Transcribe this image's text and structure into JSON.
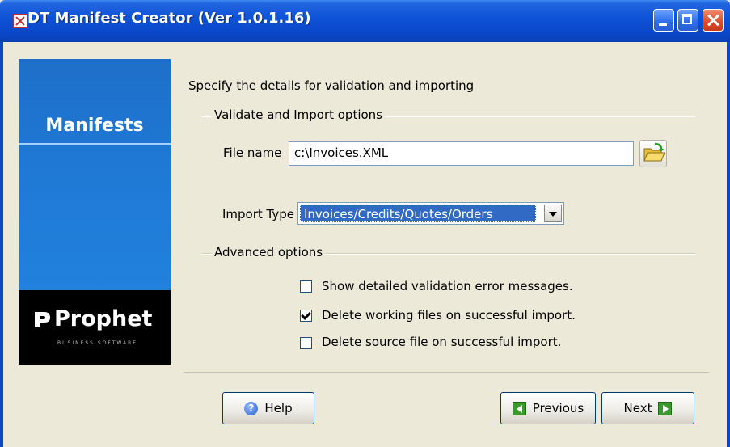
{
  "window": {
    "title": "DT Manifest Creator (Ver 1.0.1.16)"
  },
  "sidebar": {
    "title": "Manifests",
    "logo_text": "Prophet",
    "logo_subtitle": "BUSINESS SOFTWARE"
  },
  "main": {
    "intro": "Specify the details for validation and importing",
    "validate_group": {
      "label": "Validate and Import options",
      "file_name_label": "File name",
      "file_name_value": "c:\\Invoices.XML",
      "import_type_label": "Import Type",
      "import_type_value": "Invoices/Credits/Quotes/Orders"
    },
    "advanced_group": {
      "label": "Advanced options",
      "options": [
        {
          "label": "Show detailed validation error messages.",
          "checked": false
        },
        {
          "label": "Delete working files on successful import.",
          "checked": true
        },
        {
          "label": "Delete source file on successful import.",
          "checked": false
        }
      ]
    }
  },
  "footer": {
    "help_label": "Help",
    "previous_label": "Previous",
    "next_label": "Next"
  },
  "colors": {
    "titlebar": "#0a47c8",
    "sidebar_blue": "#1f7ad6",
    "selection": "#316ac5",
    "dialog_bg": "#ece9d8"
  }
}
